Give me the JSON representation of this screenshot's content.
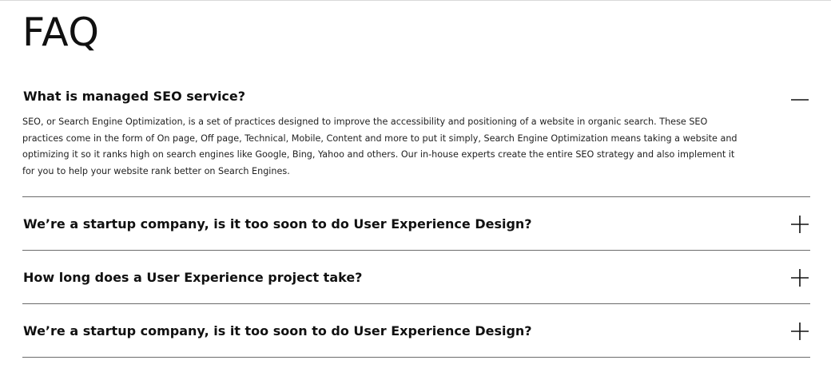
{
  "page": {
    "title": "FAQ"
  },
  "faq": {
    "items": [
      {
        "question": "What is managed SEO service?",
        "answer": "SEO, or Search Engine Optimization, is a set of practices designed to improve the accessibility and positioning of a website in organic search. These SEO practices come in the form of On page, Off page, Technical, Mobile, Content and more to put it simply, Search Engine Optimization means taking a website and optimizing it so it ranks high on search engines like Google, Bing, Yahoo and others. Our in-house experts create the entire SEO strategy and also implement it for you to help your website rank better on Search Engines.",
        "expanded": true,
        "icon": "minus-icon"
      },
      {
        "question": "We’re a startup company, is it too soon to do User Experience Design?",
        "expanded": false,
        "icon": "plus-icon"
      },
      {
        "question": "How long does a User Experience project take?",
        "expanded": false,
        "icon": "plus-icon"
      },
      {
        "question": "We’re a startup company, is it too soon to do User Experience Design?",
        "expanded": false,
        "icon": "plus-icon"
      }
    ]
  },
  "colors": {
    "text": "#111111",
    "divider": "#6b6b6b",
    "background": "#ffffff"
  }
}
